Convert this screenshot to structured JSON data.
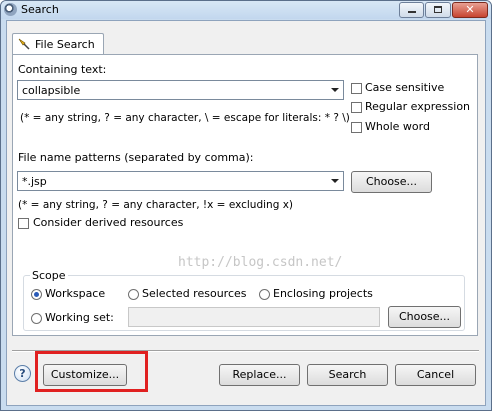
{
  "window": {
    "title": "Search"
  },
  "tab": {
    "label": "File Search"
  },
  "containing_text": {
    "label": "Containing text:",
    "value": "collapsible",
    "hint": "(* = any string, ? = any character, \\ = escape for literals: * ? \\)"
  },
  "options": {
    "case_sensitive": "Case sensitive",
    "regular_expression": "Regular expression",
    "whole_word": "Whole word"
  },
  "file_name": {
    "label": "File name patterns (separated by comma):",
    "value": "*.jsp",
    "choose": "Choose...",
    "hint": "(* = any string, ? = any character, !x = excluding x)",
    "derived": "Consider derived resources"
  },
  "scope": {
    "title": "Scope",
    "workspace": "Workspace",
    "selected": "Selected resources",
    "enclosing": "Enclosing projects",
    "working_set": "Working set:",
    "choose": "Choose..."
  },
  "watermark": "http://blog.csdn.net/",
  "buttons": {
    "customize": "Customize...",
    "replace": "Replace...",
    "search": "Search",
    "cancel": "Cancel"
  },
  "colors": {
    "highlight": "#e02020",
    "accent": "#2a5bb8"
  }
}
